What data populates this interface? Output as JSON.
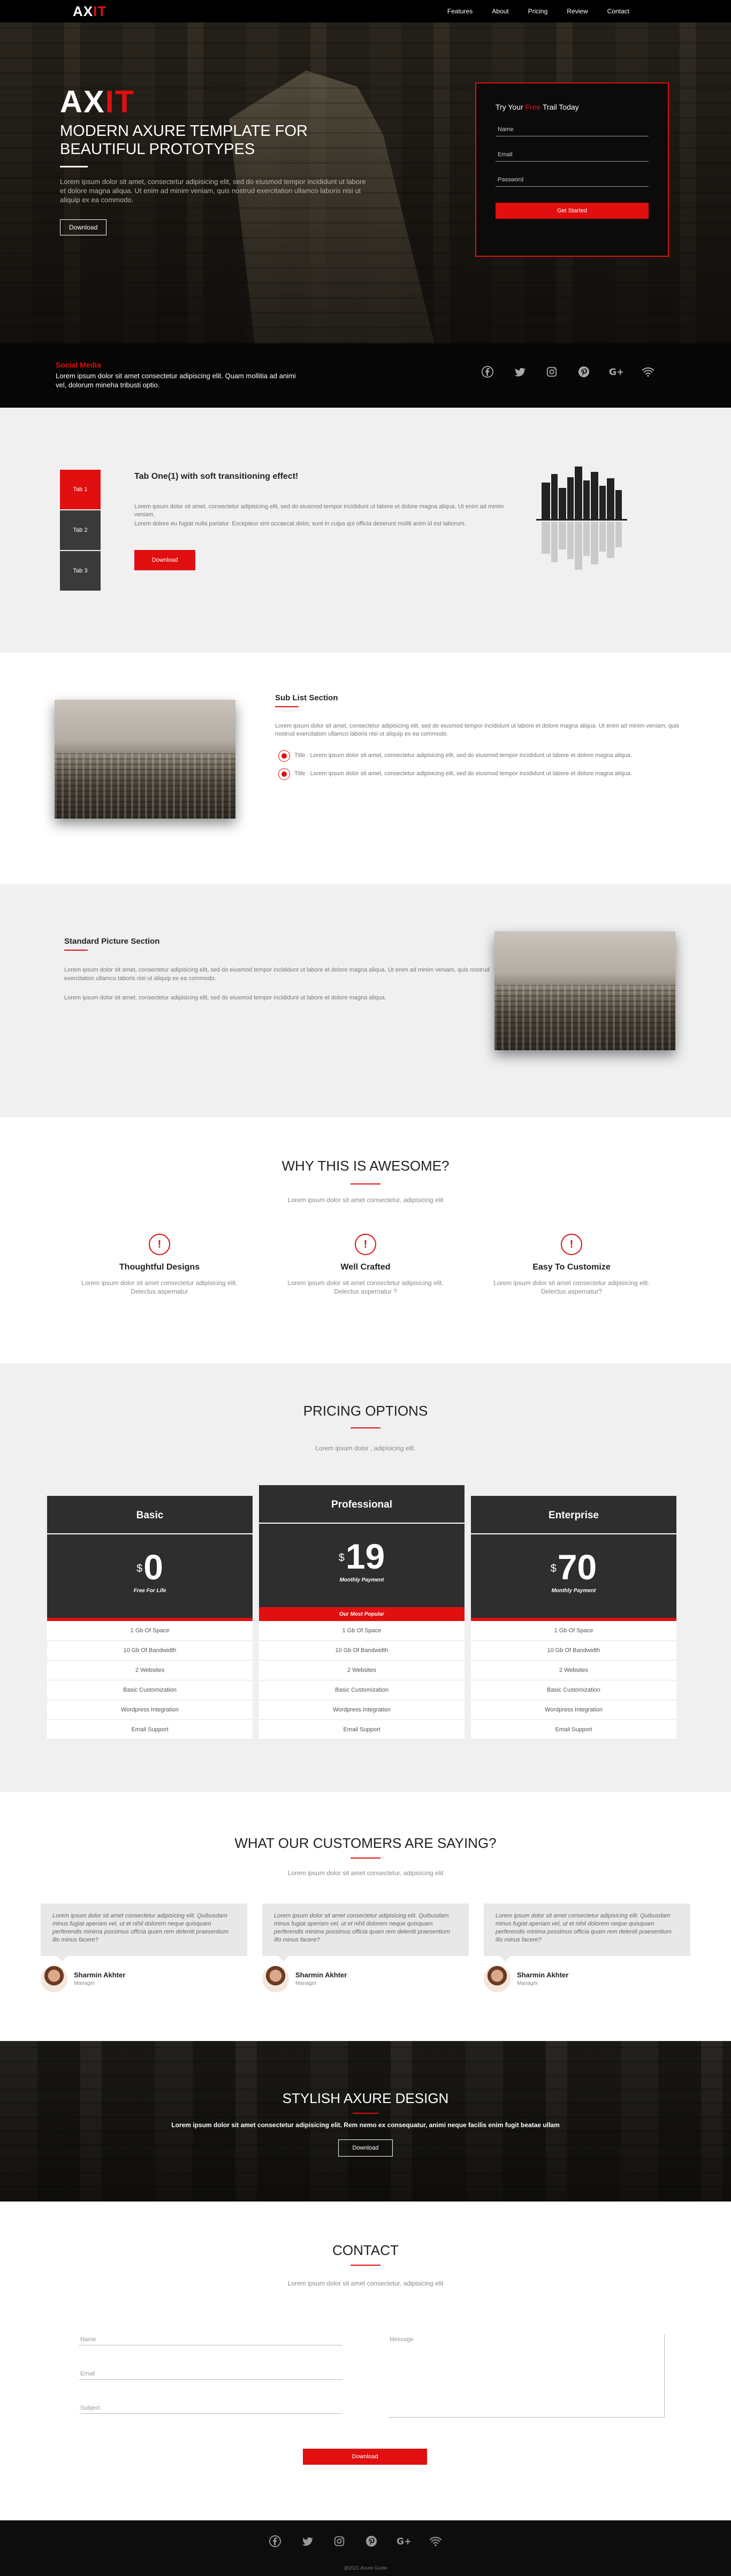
{
  "nav": {
    "logo_main": "AX",
    "logo_accent": "IT",
    "links": [
      "Features",
      "About",
      "Pricing",
      "Review",
      "Contact"
    ]
  },
  "hero": {
    "logo_main": "AX",
    "logo_accent": "IT",
    "title": "MODERN AXURE TEMPLATE FOR BEAUTIFUL PROTOTYPES",
    "desc": "Lorem ipsum dolor sit amet, consectetur adipisicing elit, sed do eiusmod tempor incididunt ut labore et dolore magna aliqua. Ut enim ad minim veniam, quis nostrud exercitation ullamco laboris nisi ut aliquip ex ea commodo.",
    "button": "Download"
  },
  "trial": {
    "title_pre": "Try Your ",
    "title_accent": "Free",
    "title_post": " Trail Today",
    "name_placeholder": "Name",
    "email_placeholder": "Email",
    "password_placeholder": "Password",
    "button": "Get Started"
  },
  "social": {
    "title": "Social Media",
    "text": "Lorem ipsum dolor sit amet consectetur adipiscing elit. Quam mollitia ad animi vel, dolorum mineha tribusti optio.",
    "icons": [
      "facebook-icon",
      "twitter-icon",
      "instagram-icon",
      "pinterest-icon",
      "google-plus-icon",
      "wifi-icon"
    ]
  },
  "tabs": {
    "labels": [
      "Tab 1",
      "Tab 2",
      "Tab 3"
    ],
    "title": "Tab One(1) with soft transitioning effect!",
    "p1": "Lorem ipsum dolor sit amet, consectetur adipisicing elit, sed do eiusmod tempor incididunt ut labore et dolore magna aliqua. Ut enim ad minim veniam.",
    "p2": "Lorem dolore eu fugiat nulla pariatur. Excepteur sint occaecat dolor, sunt in culpa qui officia deserunt mollit anim id est laborum.",
    "button": "Download"
  },
  "sublist": {
    "title": "Sub List Section",
    "desc": "Lorem ipsum dolor sit amet, consectetur adipisicing elit, sed do eiusmod tempor incididunt ut labore et dolore magna aliqua. Ut enim ad minim veniam, quis nostrud exercitation ullamco laboris nisi ut aliquip ex ea commodo.",
    "items": [
      "Title : Lorem ipsum dolor sit amet, consectetur adipisicing elit, sed do eiusmod tempor incididunt ut labore et dolore magna aliqua.",
      "Title : Lorem ipsum dolor sit amet, consectetur adipisicing elit, sed do eiusmod tempor incididunt ut labore et dolore magna aliqua."
    ]
  },
  "standard": {
    "title": "Standard Picture Section",
    "p1": "Lorem ipsum dolor sit amet, consectetur adipisicing elit, sed do eiusmod tempor incididunt ut labore et dolore magna aliqua. Ut enim ad minim veniam, quis nostrud exercitation ullamco laboris nisi ut aliquip ex ea commodo.",
    "p2": "Lorem ipsum dolor sit amet, consectetur adipisicing elit, sed do eiusmod tempor incididunt ut labore et dolore magna aliqua."
  },
  "why": {
    "title": "WHY THIS IS AWESOME?",
    "subtitle": "Lorem ipsum dolor sit amet consectetur, adipisicing elit",
    "features": [
      {
        "title": "Thoughtful Designs",
        "desc": "Lorem ipsum dolor sit amet consectetur adipisicing elit. Delectus aspernatur"
      },
      {
        "title": "Well Crafted",
        "desc": "Lorem ipsum dolor sit amet consectetur adipisicing elit. Delectus aspernatur ?"
      },
      {
        "title": "Easy To Customize",
        "desc": "Lorem ipsum dolor sit amet consectetur adipisicing elit. Delectus aspernatur?"
      }
    ]
  },
  "pricing": {
    "title": "PRICING OPTIONS",
    "subtitle": "Lorem ipsum dolor , adipisicing elit.",
    "plans": [
      {
        "name": "Basic",
        "currency": "$",
        "price": "0",
        "period": "Free For Life",
        "banner": "",
        "features": [
          "1 Gb Of Space",
          "10 Gb Of Bandwidth",
          "2 Websites",
          "Basic Customization",
          "Wordpress Integration",
          "Email Support"
        ]
      },
      {
        "name": "Professional",
        "currency": "$",
        "price": "19",
        "period": "Monthly Payment",
        "banner": "Our Most Popular",
        "features": [
          "1 Gb Of Space",
          "10 Gb Of Bandwidth",
          "2 Websites",
          "Basic Customization",
          "Wordpress Integration",
          "Email Support"
        ]
      },
      {
        "name": "Enterprise",
        "currency": "$",
        "price": "70",
        "period": "Monthly Payment",
        "banner": "",
        "features": [
          "1 Gb Of Space",
          "10 Gb Of Bandwidth",
          "2 Websites",
          "Basic Customization",
          "Wordpress Integration",
          "Email Support"
        ]
      }
    ]
  },
  "testimonials": {
    "title": "WHAT OUR CUSTOMERS ARE SAYING?",
    "subtitle": "Lorem ipsum dolor sit amet consectetur, adipisicing elit",
    "items": [
      {
        "quote": "Lorem ipsum dolor sit amet consectetur adipisicing elit. Quibusdam minus fugiat aperiam vel, ut et nihil dolorem neque quisquam perferendis minima possimus officia quam rem deleniti praesentium illo minus facere?",
        "name": "Sharmin Akhter",
        "role": "Manager"
      },
      {
        "quote": "Lorem ipsum dolor sit amet consectetur adipisicing elit. Quibusdam minus fugiat aperiam vel, ut et nihil dolorem neque quisquam perferendis minima possimus officia quam rem deleniti praesentium illo minus facere?",
        "name": "Sharmin Akhter",
        "role": "Manager"
      },
      {
        "quote": "Lorem ipsum dolor sit amet consectetur adipisicing elit. Quibusdam minus fugiat aperiam vel, ut et nihil dolorem neque quisquam perferendis minima possimus officia quam rem deleniti praesentium illo minus facere?",
        "name": "Sharmin Akhter",
        "role": "Manager"
      }
    ]
  },
  "banner": {
    "title": "STYLISH AXURE DESIGN",
    "desc": "Lorem ipsum dolor sit amet consectetur adipisicing elit. Rem nemo ex consequatur, animi neque facilis enim fugit beatae ullam",
    "button": "Download"
  },
  "contact": {
    "title": "CONTACT",
    "subtitle": "Lorem ipsum dolor sit amet consectetur, adipisicing elit",
    "name_placeholder": "Name",
    "email_placeholder": "Email",
    "subject_placeholder": "Subject",
    "message_placeholder": "Message",
    "button": "Download"
  },
  "footer": {
    "icons": [
      "facebook-icon",
      "twitter-icon",
      "instagram-icon",
      "pinterest-icon",
      "google-plus-icon",
      "wifi-icon"
    ],
    "copyright": "@2021 Axure Guide"
  },
  "colors": {
    "accent": "#e10f0f",
    "dark": "#2e2e2e",
    "light_bg": "#f0f0f0"
  }
}
